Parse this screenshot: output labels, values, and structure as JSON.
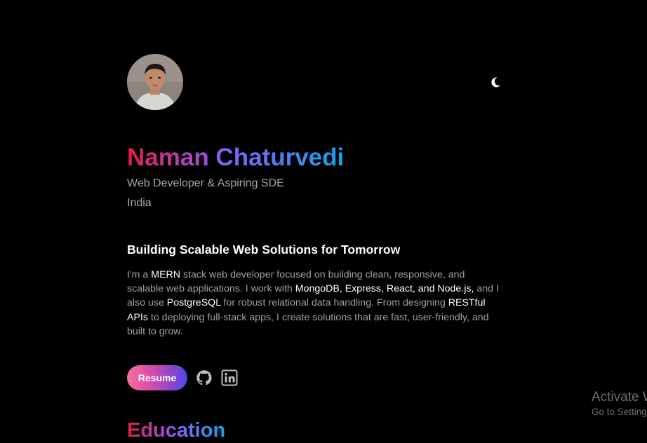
{
  "profile": {
    "name": "Naman Chaturvedi",
    "subtitle": "Web Developer & Aspiring SDE",
    "location": "India",
    "avatar_alt": "profile photo"
  },
  "theme_toggle": {
    "icon": "moon-icon"
  },
  "about": {
    "headline": "Building Scalable Web Solutions for Tomorrow",
    "segments": [
      {
        "text": "I'm a ",
        "highlight": false
      },
      {
        "text": "MERN",
        "highlight": true
      },
      {
        "text": " stack web developer focused on building clean, responsive, and scalable web applications. I work with ",
        "highlight": false
      },
      {
        "text": "MongoDB, Express, React, and Node.js,",
        "highlight": true
      },
      {
        "text": " and I also use ",
        "highlight": false
      },
      {
        "text": "PostgreSQL",
        "highlight": true
      },
      {
        "text": " for robust relational data handling. From designing ",
        "highlight": false
      },
      {
        "text": "RESTful APIs",
        "highlight": true
      },
      {
        "text": " to deploying full-stack apps, I create solutions that are fast, user-friendly, and built to grow.",
        "highlight": false
      }
    ]
  },
  "actions": {
    "resume_label": "Resume",
    "github_icon": "github-icon",
    "linkedin_icon": "linkedin-icon"
  },
  "sections": {
    "education_title": "Education"
  },
  "watermark": {
    "title": "Activate Windows",
    "subtitle": "Go to Settings to activate Windows."
  },
  "colors": {
    "background": "#000000",
    "gradient_start": "#e11d48",
    "gradient_mid": "#8b5cf6",
    "gradient_end": "#0ea5e9",
    "muted_text": "#9ca0a9",
    "highlight_text": "#ffffff"
  }
}
